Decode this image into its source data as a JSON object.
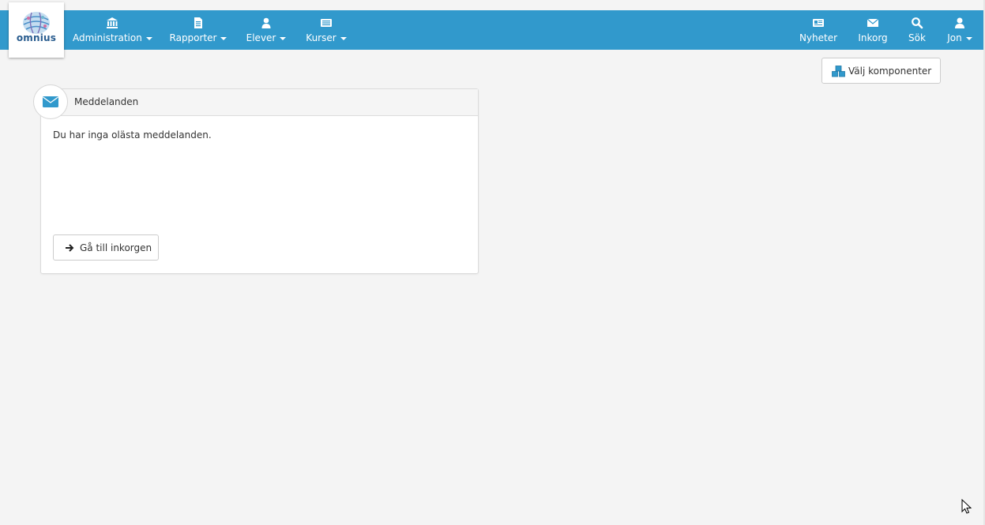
{
  "app": {
    "logo_text": "omnius"
  },
  "nav": {
    "left": [
      {
        "label": "Administration",
        "icon": "bank-icon"
      },
      {
        "label": "Rapporter",
        "icon": "document-icon"
      },
      {
        "label": "Elever",
        "icon": "user-icon"
      },
      {
        "label": "Kurser",
        "icon": "list-icon"
      }
    ],
    "right": [
      {
        "label": "Nyheter",
        "icon": "newspaper-icon"
      },
      {
        "label": "Inkorg",
        "icon": "envelope-icon"
      },
      {
        "label": "Sök",
        "icon": "search-icon"
      },
      {
        "label": "Jon",
        "icon": "user-icon"
      }
    ]
  },
  "toolbar": {
    "choose_components_label": "Välj komponenter"
  },
  "messages_panel": {
    "title": "Meddelanden",
    "body": "Du har inga olästa meddelanden.",
    "go_inbox_label": "Gå till inkorgen"
  },
  "colors": {
    "navbar": "#3199cc",
    "background": "#f4f4f4",
    "accent": "#3199cc"
  }
}
